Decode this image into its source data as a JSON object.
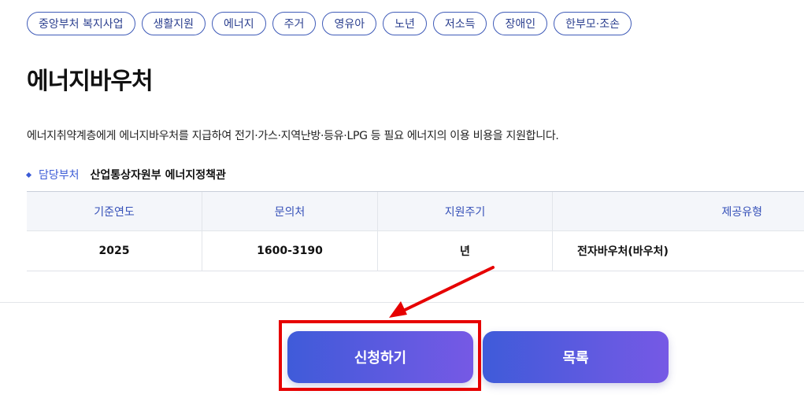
{
  "tags": [
    "중앙부처 복지사업",
    "생활지원",
    "에너지",
    "주거",
    "영유아",
    "노년",
    "저소득",
    "장애인",
    "한부모·조손"
  ],
  "title": "에너지바우처",
  "description": "에너지취약계층에게 에너지바우처를 지급하여 전기·가스·지역난방·등유·LPG 등 필요 에너지의 이용 비용을 지원합니다.",
  "department": {
    "label": "담당부처",
    "value": "산업통상자원부 에너지정책관"
  },
  "table": {
    "headers": [
      "기준연도",
      "문의처",
      "지원주기",
      "제공유형"
    ],
    "row": [
      "2025",
      "1600-3190",
      "년",
      "전자바우처(바우처)"
    ]
  },
  "buttons": {
    "apply": "신청하기",
    "list": "목록"
  },
  "colors": {
    "accent": "#3b5bd6",
    "highlight": "#e60000",
    "button_gradient_start": "#3f5bd9",
    "button_gradient_end": "#7659e5"
  }
}
